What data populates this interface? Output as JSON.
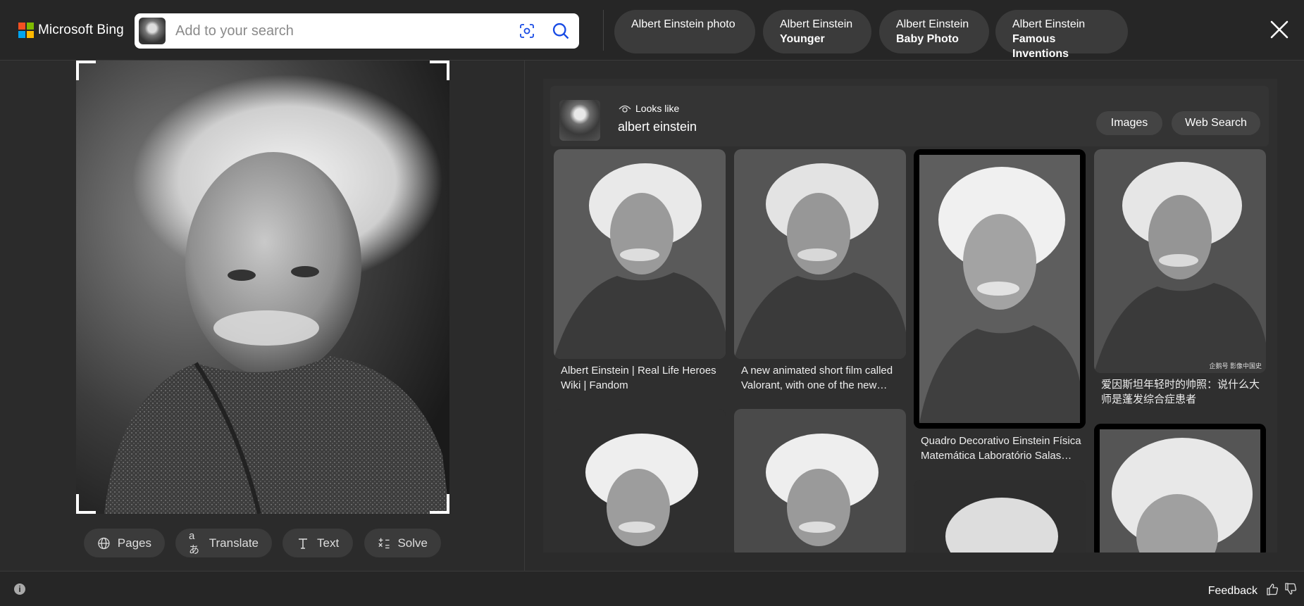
{
  "header": {
    "logo_text": "Microsoft Bing",
    "search_placeholder": "Add to your search",
    "chips": [
      {
        "line1": "Albert Einstein photo",
        "line2": ""
      },
      {
        "line1": "Albert Einstein",
        "line2": "Younger"
      },
      {
        "line1": "Albert Einstein",
        "line2": "Baby Photo"
      },
      {
        "line1": "Albert Einstein",
        "line2": "Famous Inventions"
      }
    ]
  },
  "tools": {
    "pages": "Pages",
    "translate": "Translate",
    "text": "Text",
    "solve": "Solve"
  },
  "results": {
    "looks_like_label": "Looks like",
    "entity_name": "albert einstein",
    "images_btn": "Images",
    "web_search_btn": "Web Search",
    "cards": [
      {
        "caption": "Albert Einstein | Real Life Heroes Wiki | Fandom"
      },
      {
        "caption": "A new animated short film called Valorant, with one of the new…"
      },
      {
        "caption": "Quadro Decorativo Einstein Física Matemática Laboratório Salas…"
      },
      {
        "caption": "爱因斯坦年轻时的帅照：说什么大师是蓬发综合症患者",
        "watermark": "企鹅号 影像中国史"
      }
    ]
  },
  "footer": {
    "info_icon": "i",
    "feedback": "Feedback"
  },
  "colors": {
    "background": "#2b2b2b",
    "header_bg": "#262626",
    "chip_bg": "#3b3b3b",
    "search_icon_blue": "#174ae4"
  }
}
